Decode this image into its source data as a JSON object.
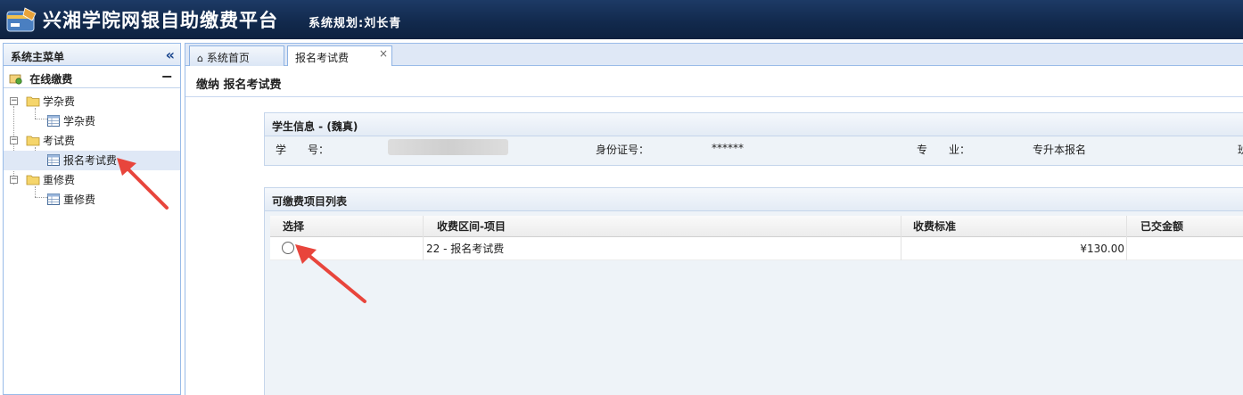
{
  "header": {
    "title": "兴湘学院网银自助缴费平台",
    "subtitle": "系统规划:刘长青"
  },
  "sidebar": {
    "title": "系统主菜单",
    "accordion_title": "在线缴费",
    "tree": [
      {
        "label": "学杂费",
        "children": [
          {
            "label": "学杂费"
          }
        ]
      },
      {
        "label": "考试费",
        "children": [
          {
            "label": "报名考试费",
            "selected": true
          }
        ]
      },
      {
        "label": "重修费",
        "children": [
          {
            "label": "重修费"
          }
        ]
      }
    ]
  },
  "tabs": [
    {
      "label": "系统首页",
      "active": false
    },
    {
      "label": "报名考试费",
      "active": true
    }
  ],
  "page": {
    "title": "缴纳 报名考试费"
  },
  "student_panel": {
    "title": "学生信息 - (魏真)",
    "fields": {
      "student_no_label": "学　　号：",
      "id_label": "身份证号：",
      "id_value": "******",
      "major_label": "专　　业：",
      "major_value": "专升本报名",
      "class_label_partial": "班"
    }
  },
  "fee_panel": {
    "title": "可缴费项目列表",
    "columns": [
      "选择",
      "收费区间-项目",
      "收费标准",
      "已交金额"
    ],
    "rows": [
      {
        "item": "22 - 报名考试费",
        "standard": "¥130.00",
        "paid": ""
      }
    ]
  },
  "colors": {
    "header_bg": "#122a4d",
    "border": "#99bbe8",
    "arrow": "#e8453c"
  }
}
